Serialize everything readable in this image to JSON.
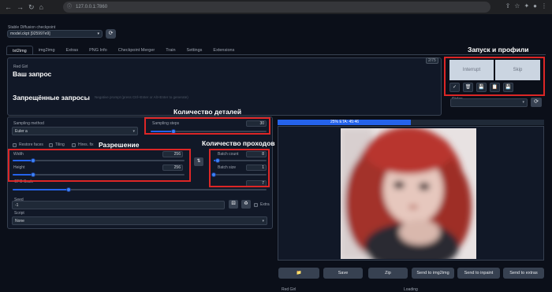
{
  "browser": {
    "url": "127.0.0.1:7860"
  },
  "checkpoint": {
    "label": "Stable Diffusion checkpoint",
    "value": "model.ckpt [925997e9]"
  },
  "tabs": [
    {
      "label": "txt2img",
      "active": true
    },
    {
      "label": "img2img"
    },
    {
      "label": "Extras"
    },
    {
      "label": "PNG Info"
    },
    {
      "label": "Checkpoint Merger"
    },
    {
      "label": "Train"
    },
    {
      "label": "Settings"
    },
    {
      "label": "Extensions"
    }
  ],
  "prompt": {
    "label": "Red Girl",
    "token_count": "2/75",
    "negative_placeholder": "Negative prompt (press Ctrl+Enter or Alt+Enter to generate)"
  },
  "buttons": {
    "interrupt": "Interrupt",
    "skip": "Skip"
  },
  "tools": [
    "✓",
    "🗑",
    "💾",
    "📋",
    "💾"
  ],
  "styles": {
    "label": "Styles"
  },
  "settings": {
    "sampling_method_label": "Sampling method",
    "sampling_method_value": "Euler a",
    "sampling_steps_label": "Sampling steps",
    "sampling_steps_value": "30",
    "sampling_steps_fraction": 0.2,
    "restore_faces": "Restore faces",
    "tiling": "Tiling",
    "hires_fix": "Hires. fix",
    "width_label": "Width",
    "width_value": "256",
    "width_fraction": 0.12,
    "height_label": "Height",
    "height_value": "256",
    "height_fraction": 0.12,
    "batch_count_label": "Batch count",
    "batch_count_value": "8",
    "batch_count_fraction": 0.07,
    "batch_size_label": "Batch size",
    "batch_size_value": "1",
    "batch_size_fraction": 0.0,
    "cfg_label": "CFG Scale",
    "cfg_value": "7",
    "cfg_fraction": 0.22,
    "seed_label": "Seed",
    "seed_value": "-1",
    "extra_label": "Extra",
    "script_label": "Script",
    "script_value": "None"
  },
  "annotations": {
    "query": "Ваш запрос",
    "negative": "Запрещённые запросы",
    "launch": "Запуск и профили",
    "detail": "Количество деталей",
    "resolution": "Разрешение",
    "passes": "Количество проходов"
  },
  "output": {
    "progress_text": "25% ETA: 45:46",
    "progress_fraction": 0.25
  },
  "output_buttons": {
    "folder": "📁",
    "save": "Save",
    "zip": "Zip",
    "img2img": "Send to img2img",
    "inpaint": "Send to inpaint",
    "extras": "Send to extras"
  },
  "bottom_labels": {
    "left": "Red Girl",
    "right": "Loading"
  },
  "colors": {
    "accent": "#2563eb",
    "annotation_box": "#dc2626",
    "background": "#0b0f19",
    "panel": "#111827"
  }
}
